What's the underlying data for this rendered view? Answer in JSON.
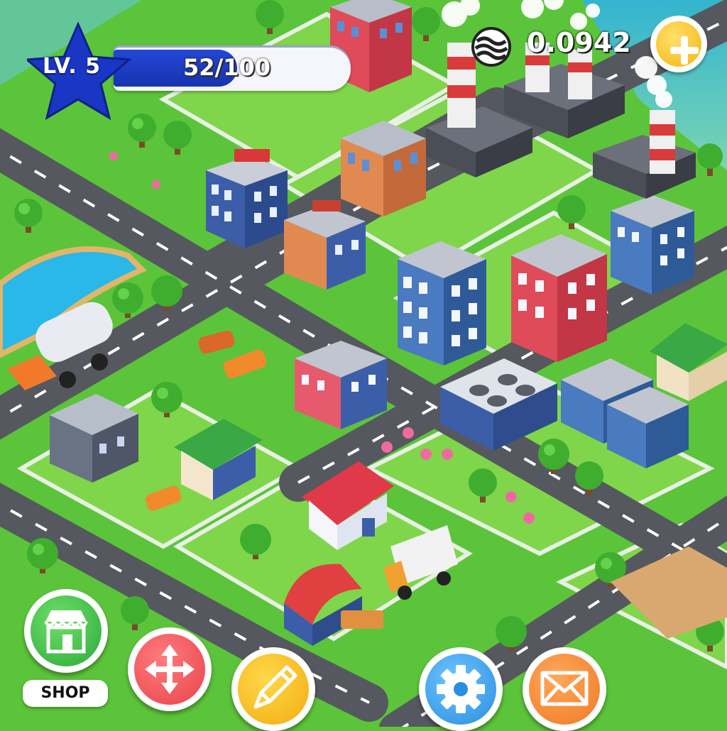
{
  "hud": {
    "level_label": "LV. 5",
    "xp_text": "52/100",
    "xp_progress": 0.52,
    "currency_value": "0.0942",
    "currency_icon": "coin-stack-icon",
    "add_icon": "plus-icon"
  },
  "toolbar": {
    "shop_label": "SHOP",
    "buttons": [
      {
        "name": "shop",
        "icon": "storefront-icon",
        "color": "#3cc04a"
      },
      {
        "name": "move",
        "icon": "move-arrows-icon",
        "color": "#f0555a"
      },
      {
        "name": "edit",
        "icon": "pencil-icon",
        "color": "#f6b820"
      },
      {
        "name": "settings",
        "icon": "gear-icon",
        "color": "#3aa0ee"
      },
      {
        "name": "mail",
        "icon": "envelope-icon",
        "color": "#f58a3a"
      }
    ]
  },
  "colors": {
    "grass": "#5cc43a",
    "road": "#55585e",
    "water": "#29b8e8",
    "xp_fill": "#1e3fc8",
    "level_star": "#1a36c4"
  }
}
